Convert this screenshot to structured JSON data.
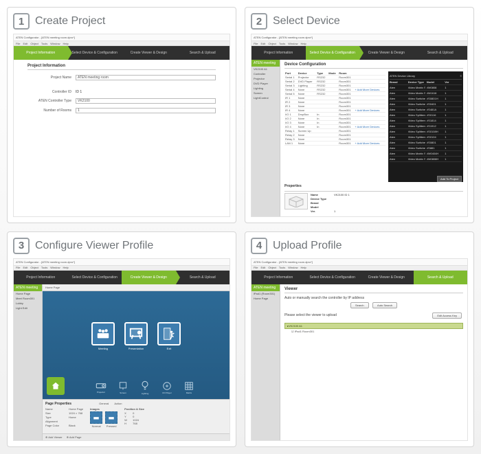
{
  "steps": [
    {
      "num": "1",
      "title": "Create Project"
    },
    {
      "num": "2",
      "title": "Select Device"
    },
    {
      "num": "3",
      "title": "Configure Viewer Profile"
    },
    {
      "num": "4",
      "title": "Upload Profile"
    }
  ],
  "app": {
    "window_title": "ATEN Configurator - [ATEN meeting room.dpro*]",
    "menus": [
      "File",
      "Edit",
      "Object",
      "Tools",
      "Window",
      "Help"
    ],
    "tabs": [
      "Project Information",
      "Select Device & Configuration",
      "Create Viewer & Design",
      "Search & Upload"
    ],
    "sidebar_title": "ATEN meeting",
    "sidebar_items_p1": [],
    "sidebar_items_p2": [
      "VK2100 A1",
      "Controller",
      "Projector",
      "DVD Player",
      "Lighting",
      "Screen",
      "LightControl"
    ],
    "sidebar_items_p3": [
      "Home Page",
      "Meet Room301",
      "Lobby",
      "Light Edit"
    ],
    "sidebar_items_p4": [
      "iPad1 (Room301)",
      "Home Page"
    ]
  },
  "panel1": {
    "heading": "Project Information",
    "rows": [
      {
        "label": "Project Name",
        "value": "ATEN meeting room"
      },
      {
        "label": "Controller ID",
        "value": "ID 1"
      },
      {
        "label": "ATEN Controller Type",
        "value": "VK2100"
      },
      {
        "label": "Number of Rooms",
        "value": "1"
      }
    ]
  },
  "panel2": {
    "heading": "Device Configuration",
    "columns": [
      "Port",
      "Device",
      "Type",
      "Mode",
      "Room"
    ],
    "rows": [
      [
        "Serial 1",
        "Projector",
        "RS232",
        "",
        "Room301"
      ],
      [
        "Serial 2",
        "DVD Player",
        "RS232",
        "",
        "Room301"
      ],
      [
        "Serial 3",
        "Lighting",
        "RS232",
        "",
        "Room301"
      ],
      [
        "Serial 4",
        "None",
        "RS232",
        "",
        "Room301"
      ],
      [
        "Serial 5",
        "None",
        "RS232",
        "",
        "Room301"
      ],
      [
        "IR 1",
        "None",
        "",
        "",
        "Room301"
      ],
      [
        "IR 2",
        "None",
        "",
        "",
        "Room301"
      ],
      [
        "IR 3",
        "None",
        "",
        "",
        "Room301"
      ],
      [
        "IR 4",
        "None",
        "",
        "",
        "Room301"
      ],
      [
        "I/O 1",
        "DropBox",
        "In",
        "",
        "Room301"
      ],
      [
        "I/O 2",
        "None",
        "In",
        "",
        "Room301"
      ],
      [
        "I/O 3",
        "None",
        "In",
        "",
        "Room301"
      ],
      [
        "I/O 4",
        "None",
        "In",
        "",
        "Room301"
      ],
      [
        "Relay 1",
        "Screen Up",
        "",
        "",
        "Room301"
      ],
      [
        "Relay 2",
        "None",
        "",
        "",
        "Room301"
      ],
      [
        "Relay 3",
        "None",
        "",
        "",
        "Room301"
      ],
      [
        "LAN 1",
        "None",
        "",
        "",
        "Room301"
      ]
    ],
    "add_label": "+ Add More Devices",
    "lib_title": "ATEN Device Library",
    "lib_cols": [
      "Brand",
      "Device Type",
      "Model",
      "Ver"
    ],
    "lib_rows": [
      [
        "Aten",
        "Video Matrix Switch",
        "VM0808",
        "1"
      ],
      [
        "Aten",
        "Video Matrix Switch",
        "VM1616",
        "1"
      ],
      [
        "Aten",
        "Video Switches",
        "VS0801H",
        "1"
      ],
      [
        "Aten",
        "Video Switches",
        "VS0401",
        "1"
      ],
      [
        "Aten",
        "Video Switches",
        "VS481A",
        "1"
      ],
      [
        "Aten",
        "Video Splitters",
        "VS0116",
        "1"
      ],
      [
        "Aten",
        "Video Splitters",
        "VS1814",
        "1"
      ],
      [
        "Aten",
        "Video Splitters",
        "VS1912",
        "1"
      ],
      [
        "Aten",
        "Video Splitters",
        "VS0108H",
        "1"
      ],
      [
        "Aten",
        "Video Splitters",
        "VS0104",
        "1"
      ],
      [
        "Aten",
        "Video Switches",
        "VS0801",
        "1"
      ],
      [
        "Aten",
        "Video Switches",
        "VS881",
        "1"
      ],
      [
        "Aten",
        "Video Matrix Switch",
        "VM0404H",
        "1"
      ],
      [
        "Aten",
        "Video Matrix Switch",
        "VM0808H",
        "1"
      ]
    ],
    "lib_add_btn": "Add To Project",
    "prop_title": "Properties",
    "props": [
      [
        "Name",
        "VK2100 ID 1"
      ],
      [
        "Device Type",
        ""
      ],
      [
        "Brand",
        ""
      ],
      [
        "Model",
        ""
      ],
      [
        "Ver.",
        "1"
      ]
    ]
  },
  "panel3": {
    "tab_label": "Home Page",
    "tiles": [
      "Meeting",
      "Presentation",
      "Exit"
    ],
    "small": [
      "Projector",
      "Screen",
      "Lighting",
      "CD Player",
      "Matrix"
    ],
    "props_title": "Page Properties",
    "props_tabs": [
      "General",
      "Action"
    ],
    "col1": [
      [
        "Name",
        "Home Page"
      ],
      [
        "Size",
        "1024 × 768"
      ],
      [
        "Type",
        "Home"
      ],
      [
        "Alignment",
        ""
      ],
      [
        "Page Color",
        "Black"
      ]
    ],
    "col2_title": "Images",
    "col2_items": [
      "Normal",
      "Pressed"
    ],
    "col3_title": "Position & Size",
    "col3": [
      [
        "X",
        "0"
      ],
      [
        "Y",
        "0"
      ],
      [
        "W",
        "1024"
      ],
      [
        "H",
        "768"
      ]
    ],
    "bottom": [
      "Add Viewer",
      "Add Page"
    ]
  },
  "panel4": {
    "heading": "Viewer",
    "line1": "Auto or manually search the controller by IP address",
    "btn_search": "Search",
    "btn_auto": "Auto Search",
    "line2": "Please select the viewer to upload",
    "btn_editkey": "Edit Access Key",
    "device_head": "VK2100 A1",
    "device_row": "☑  iPad1   Room301"
  }
}
